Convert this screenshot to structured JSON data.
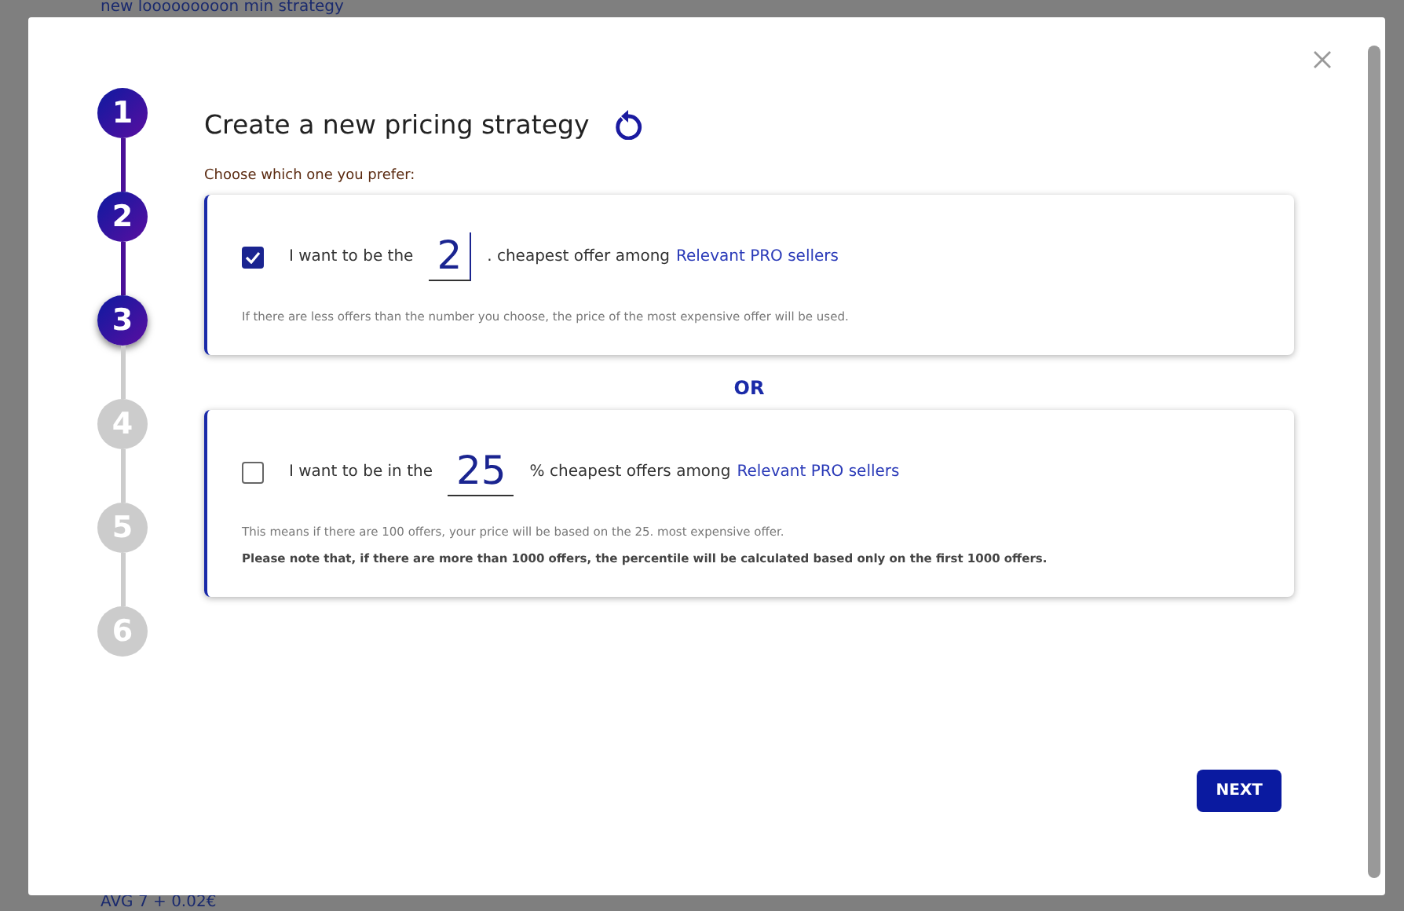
{
  "background": {
    "top_text": "new looooooooon min strategy",
    "bottom_text": "AVG 7 + 0.02€"
  },
  "steps": [
    {
      "label": "1",
      "completed": true,
      "current": false
    },
    {
      "label": "2",
      "completed": true,
      "current": false
    },
    {
      "label": "3",
      "completed": true,
      "current": true
    },
    {
      "label": "4",
      "completed": false,
      "current": false
    },
    {
      "label": "5",
      "completed": false,
      "current": false
    },
    {
      "label": "6",
      "completed": false,
      "current": false
    }
  ],
  "title": "Create a new pricing strategy",
  "prompt": "Choose which one you prefer:",
  "options": [
    {
      "checked": true,
      "before": "I want to be the",
      "value": "2",
      "after": ". cheapest offer among",
      "link": "Relevant PRO sellers",
      "notes": [
        {
          "text": "If there are less offers than the number you choose, the price of the most expensive offer will be used.",
          "emphasis": false
        }
      ]
    },
    {
      "checked": false,
      "before": "I want to be in the",
      "value": "25",
      "after": "% cheapest offers among",
      "link": "Relevant PRO sellers",
      "notes": [
        {
          "text": "This means if there are 100 offers, your price will be based on the 25. most expensive offer.",
          "emphasis": false
        },
        {
          "text": "Please note that, if there are more than 1000 offers, the percentile will be calculated based only on the first 1000 offers.",
          "emphasis": true
        }
      ]
    }
  ],
  "separator": "OR",
  "next_button": "NEXT"
}
